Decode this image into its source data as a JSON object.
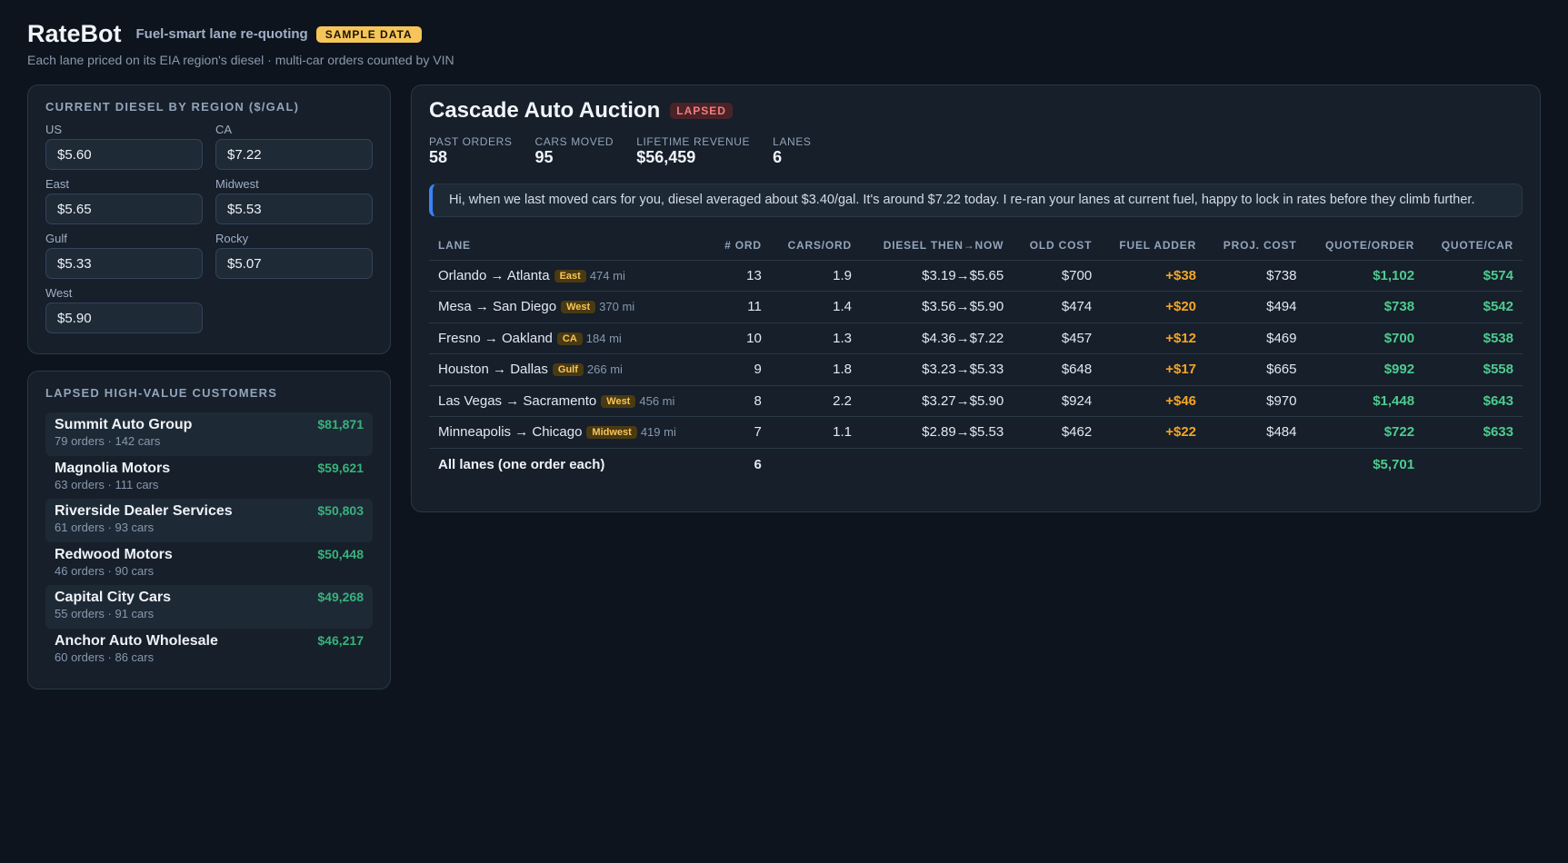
{
  "app": {
    "title": "RateBot",
    "tagline": "Fuel-smart lane re-quoting",
    "badge": "SAMPLE DATA",
    "subtitle": "Each lane priced on its EIA region's diesel · multi-car orders counted by VIN"
  },
  "diesel": {
    "heading": "Current diesel by region ($/gal)",
    "regions": [
      {
        "label": "US",
        "value": "$5.60"
      },
      {
        "label": "CA",
        "value": "$7.22"
      },
      {
        "label": "East",
        "value": "$5.65"
      },
      {
        "label": "Midwest",
        "value": "$5.53"
      },
      {
        "label": "Gulf",
        "value": "$5.33"
      },
      {
        "label": "Rocky",
        "value": "$5.07"
      },
      {
        "label": "West",
        "value": "$5.90"
      }
    ]
  },
  "customers": {
    "heading": "Lapsed high-value customers",
    "items": [
      {
        "name": "Summit Auto Group",
        "meta": "79 orders · 142 cars",
        "value": "$81,871"
      },
      {
        "name": "Magnolia Motors",
        "meta": "63 orders · 111 cars",
        "value": "$59,621"
      },
      {
        "name": "Riverside Dealer Services",
        "meta": "61 orders · 93 cars",
        "value": "$50,803"
      },
      {
        "name": "Redwood Motors",
        "meta": "46 orders · 90 cars",
        "value": "$50,448"
      },
      {
        "name": "Capital City Cars",
        "meta": "55 orders · 91 cars",
        "value": "$49,268"
      },
      {
        "name": "Anchor Auto Wholesale",
        "meta": "60 orders · 86 cars",
        "value": "$46,217"
      }
    ]
  },
  "selected": {
    "name": "Cascade Auto Auction",
    "status": "LAPSED",
    "stats": [
      {
        "label": "Past orders",
        "value": "58"
      },
      {
        "label": "Cars moved",
        "value": "95"
      },
      {
        "label": "Lifetime revenue",
        "value": "$56,459"
      },
      {
        "label": "Lanes",
        "value": "6"
      }
    ],
    "message": "Hi, when we last moved cars for you, diesel averaged about $3.40/gal. It's around $7.22 today. I re-ran your lanes at current fuel, happy to lock in rates before they climb further."
  },
  "table": {
    "columns": [
      "Lane",
      "# Ord",
      "Cars/Ord",
      "Diesel then→now",
      "Old cost",
      "Fuel adder",
      "Proj. cost",
      "Quote/Order",
      "Quote/Car"
    ],
    "rows": [
      {
        "lane": "Orlando → Atlanta",
        "region": "East",
        "miles": "474 mi",
        "orders": "13",
        "cars_per_order": "1.9",
        "diesel": "$3.19→$5.65",
        "old_cost": "$700",
        "fuel_adder": "+$38",
        "proj_cost": "$738",
        "quote_order": "$1,102",
        "quote_car": "$574"
      },
      {
        "lane": "Mesa → San Diego",
        "region": "West",
        "miles": "370 mi",
        "orders": "11",
        "cars_per_order": "1.4",
        "diesel": "$3.56→$5.90",
        "old_cost": "$474",
        "fuel_adder": "+$20",
        "proj_cost": "$494",
        "quote_order": "$738",
        "quote_car": "$542"
      },
      {
        "lane": "Fresno → Oakland",
        "region": "CA",
        "miles": "184 mi",
        "orders": "10",
        "cars_per_order": "1.3",
        "diesel": "$4.36→$7.22",
        "old_cost": "$457",
        "fuel_adder": "+$12",
        "proj_cost": "$469",
        "quote_order": "$700",
        "quote_car": "$538"
      },
      {
        "lane": "Houston → Dallas",
        "region": "Gulf",
        "miles": "266 mi",
        "orders": "9",
        "cars_per_order": "1.8",
        "diesel": "$3.23→$5.33",
        "old_cost": "$648",
        "fuel_adder": "+$17",
        "proj_cost": "$665",
        "quote_order": "$992",
        "quote_car": "$558"
      },
      {
        "lane": "Las Vegas → Sacramento",
        "region": "West",
        "miles": "456 mi",
        "orders": "8",
        "cars_per_order": "2.2",
        "diesel": "$3.27→$5.90",
        "old_cost": "$924",
        "fuel_adder": "+$46",
        "proj_cost": "$970",
        "quote_order": "$1,448",
        "quote_car": "$643"
      },
      {
        "lane": "Minneapolis → Chicago",
        "region": "Midwest",
        "miles": "419 mi",
        "orders": "7",
        "cars_per_order": "1.1",
        "diesel": "$2.89→$5.53",
        "old_cost": "$462",
        "fuel_adder": "+$22",
        "proj_cost": "$484",
        "quote_order": "$722",
        "quote_car": "$633"
      }
    ],
    "total": {
      "label": "All lanes (one order each)",
      "orders": "6",
      "quote_order": "$5,701"
    }
  }
}
